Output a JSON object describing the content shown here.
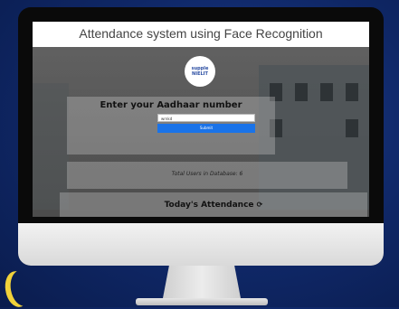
{
  "app": {
    "title": "Attendance system using Face Recognition"
  },
  "logo": {
    "line1": "supple",
    "line2": "NIELIT"
  },
  "form": {
    "heading": "Enter your Aadhaar number",
    "input_value": "wrnkd",
    "submit_label": "Submit"
  },
  "stats": {
    "total_users_text": "Total Users in Database: 6"
  },
  "attendance": {
    "heading": "Today's Attendance",
    "refresh_icon": "refresh-icon"
  },
  "colors": {
    "background": "#13317a",
    "submit": "#1a73e8",
    "moon": "#f1d23a"
  }
}
